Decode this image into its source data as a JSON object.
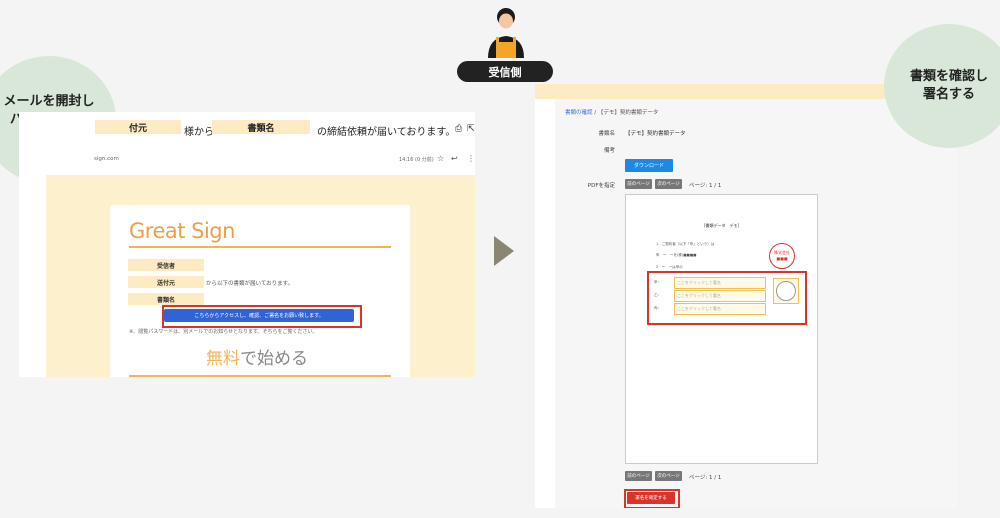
{
  "left_circle": {
    "text": "メールを開封し\nパスワードを\n入力する"
  },
  "right_circle": {
    "text": "書類を確認し\n署名する"
  },
  "receiver": {
    "label": "受信側"
  },
  "email": {
    "sender_box": "付元",
    "sama_kara": "様から",
    "document_box": "書類名",
    "subject_tail": "の締結依頼が届いております。",
    "sender_domain": "sign.com",
    "time": "14:16 (0 分前)",
    "card": {
      "logo": "Great Sign",
      "recipient_label": "受信者",
      "sender_label": "送付元",
      "sender_suffix": "から以下の書類が届いております。",
      "document_label": "書類名",
      "access_button": "こちらからアクセスし、確認、ご署名をお願い致します。",
      "note": "※、閲覧パスワードは、別メールでのお知らせとなります。そちらをご覧ください。",
      "free_start_prefix": "無料",
      "free_start_suffix": "で始める"
    }
  },
  "viewer": {
    "breadcrumb_link": "書類の確認",
    "breadcrumb_sep": "/",
    "breadcrumb_current": "【デモ】契約書類データ",
    "doc_name_label": "書類名",
    "doc_name_value": "【デモ】契約書類データ",
    "note_label": "備考",
    "download_button": "ダウンロード",
    "pdf_label": "PDFを指定",
    "prev_button": "前のページ",
    "next_button": "次のページ",
    "page_indicator": "ページ: 1 / 1",
    "pdf": {
      "title": "[書類データ　デモ]",
      "line1": "1　ご契約者（以下「甲」という）は",
      "line2": "甲　ー　ーを(株)■■■■",
      "line3": "2　ー　ーは甲の",
      "stamp_top": "株式会社",
      "stamp_bottom": "■■■",
      "sig_placeholder": "ここをクリックして署名",
      "sig_labels": [
        "甲：",
        "乙：",
        "丙："
      ]
    },
    "confirm_button": "署名を確定する"
  },
  "colors": {
    "accent_red": "#d9342b",
    "highlight_yellow": "#fdecc3",
    "circle_green": "#d9e7d8",
    "primary_blue": "#2f63d6"
  }
}
